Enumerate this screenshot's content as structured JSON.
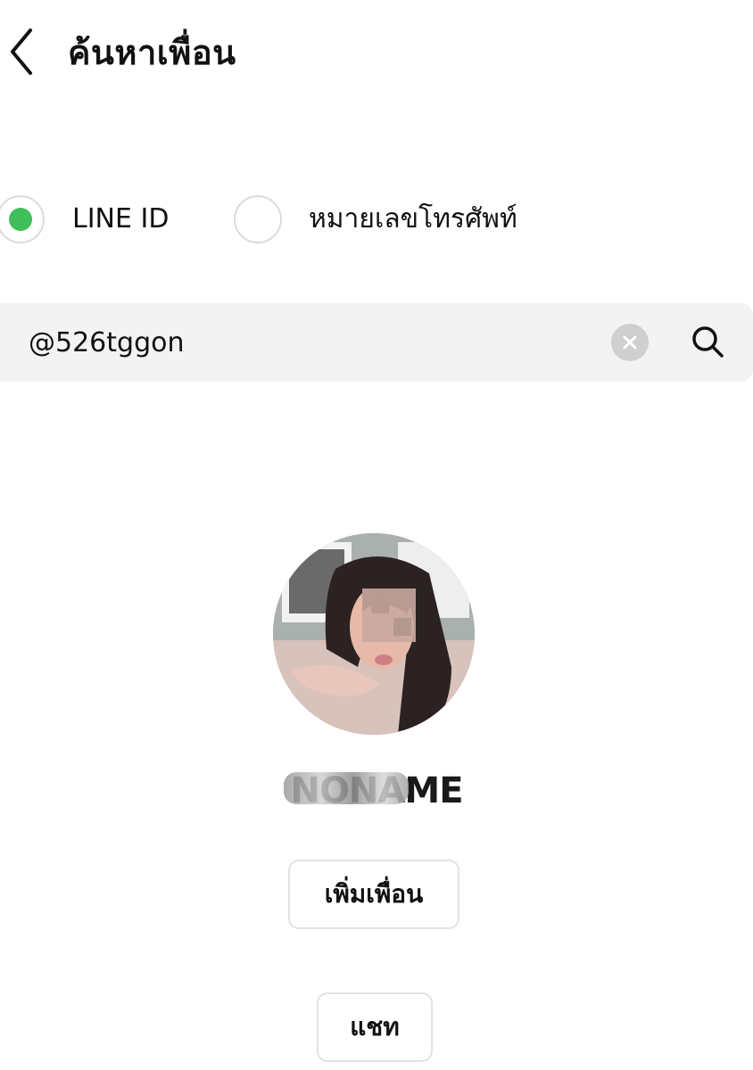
{
  "header": {
    "title": "ค้นหาเพื่อน",
    "back_icon": "chevron-left-icon"
  },
  "search_type": {
    "options": [
      {
        "label": "LINE ID",
        "selected": true
      },
      {
        "label": "หมายเลขโทรศัพท์",
        "selected": false
      }
    ],
    "selected_color": "#3fbe5a"
  },
  "search": {
    "value": "@526tggon",
    "clear_icon": "clear-icon",
    "search_icon": "search-icon"
  },
  "profile": {
    "name": "NONAME"
  },
  "actions": {
    "add_friend_label": "เพิ่มเพื่อน",
    "chat_label": "แชท"
  }
}
